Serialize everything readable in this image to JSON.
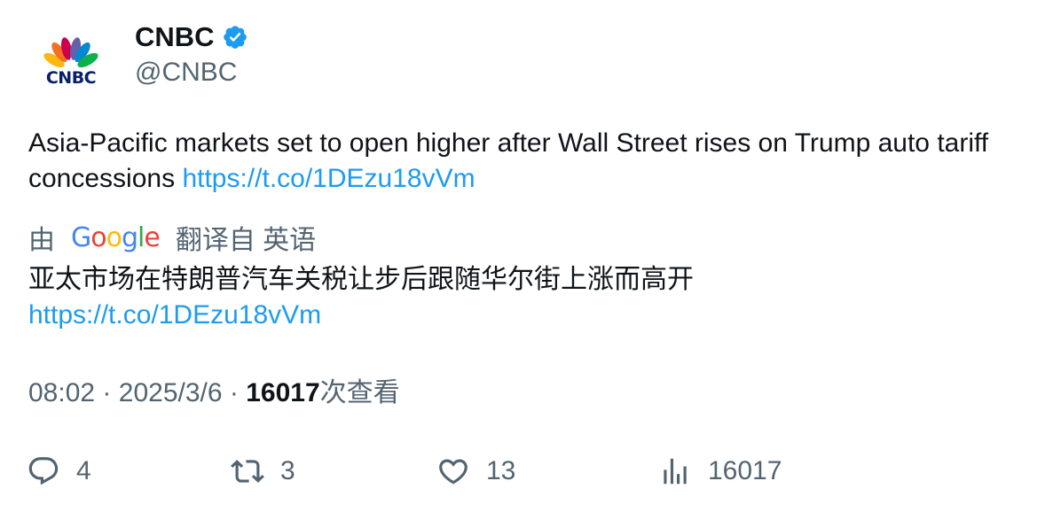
{
  "author": {
    "display_name": "CNBC",
    "handle": "@CNBC",
    "avatar_text": "CNBC",
    "verified_icon": "verified-badge-icon",
    "verified_color": "#1d9bf0"
  },
  "tweet": {
    "text": "Asia-Pacific markets set to open higher after Wall Street rises on Trump auto tariff concessions",
    "link": "https://t.co/1DEzu18vVm"
  },
  "translation": {
    "prefix": "由",
    "provider": "Google",
    "suffix": "翻译自 英语",
    "text": "亚太市场在特朗普汽车关税让步后跟随华尔街上涨而高开",
    "link": "https://t.co/1DEzu18vVm"
  },
  "meta": {
    "time": "08:02",
    "separator": "·",
    "date": "2025/3/6",
    "views": "16017",
    "views_label": "次查看"
  },
  "actions": {
    "replies": "4",
    "retweets": "3",
    "likes": "13",
    "views": "16017"
  },
  "colors": {
    "text_primary": "#0f1419",
    "text_secondary": "#536471",
    "link": "#1d9bf0"
  }
}
